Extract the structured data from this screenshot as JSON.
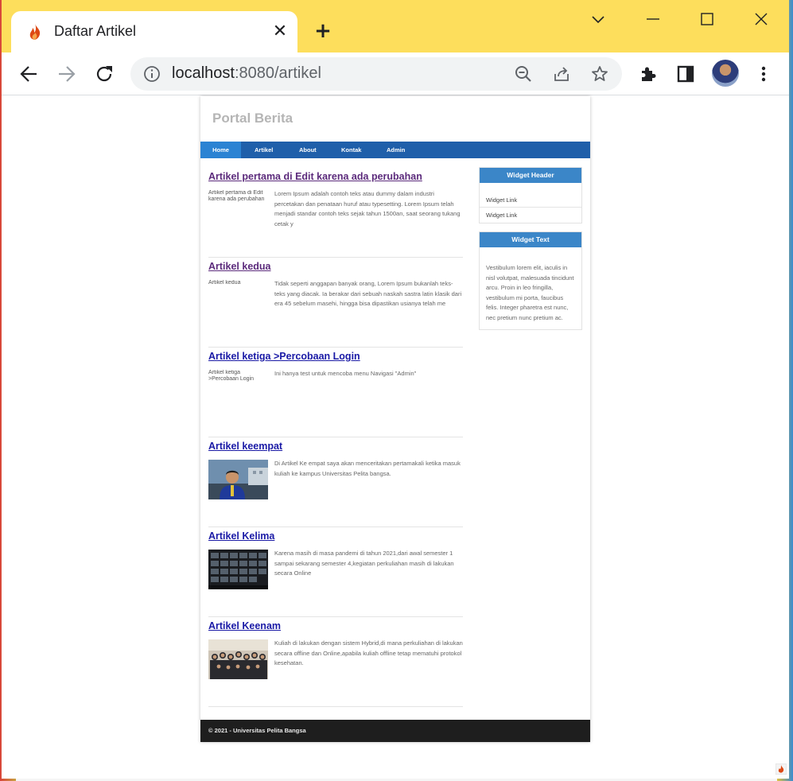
{
  "browser": {
    "tab_title": "Daftar Artikel",
    "url_host": "localhost",
    "url_rest": ":8080/artikel"
  },
  "colors": {
    "tabbar": "#fdde5c",
    "navbar": "#1f5faa",
    "nav_active": "#2b83d3",
    "widget_header": "#3b86c8",
    "footer": "#1e1e1e"
  },
  "site": {
    "title": "Portal Berita",
    "nav": [
      {
        "label": "Home",
        "active": true
      },
      {
        "label": "Artikel"
      },
      {
        "label": "About"
      },
      {
        "label": "Kontak"
      },
      {
        "label": "Admin"
      }
    ]
  },
  "articles": [
    {
      "title": "Artikel pertama di Edit karena ada perubahan",
      "image_alt": "Artikel pertama di Edit karena ada perubahan",
      "image": "broken",
      "text": "Lorem Ipsum adalah contoh teks atau dummy dalam industri percetakan dan penataan huruf atau typesetting. Lorem Ipsum telah menjadi standar contoh teks sejak tahun 1500an, saat seorang tukang cetak y",
      "visited": true
    },
    {
      "title": "Artikel kedua",
      "image_alt": "Artikel kedua",
      "image": "broken",
      "text": "Tidak seperti anggapan banyak orang, Lorem Ipsum bukanlah teks-teks yang diacak. Ia berakar dari sebuah naskah sastra latin klasik dari era 45 sebelum masehi, hingga bisa dipastikan usianya telah me",
      "visited": true
    },
    {
      "title": "Artikel ketiga >Percobaan Login",
      "image_alt": "Artikel ketiga >Percobaan Login",
      "image": "broken",
      "text": "Ini hanya test untuk mencoba menu Navigasi \"Admin\"",
      "visited": false
    },
    {
      "title": "Artikel keempat",
      "image_alt": "",
      "image": "portrait-photo",
      "text": "Di Artikel Ke empat saya akan menceritakan pertamakali ketika masuk kuliah ke kampus Universitas Pelita bangsa.",
      "visited": false
    },
    {
      "title": "Artikel Kelima",
      "image_alt": "",
      "image": "video-call-photo",
      "text": "Karena masih di masa pandemi di tahun 2021,dari awal semester 1 sampai sekarang semester 4,kegiatan perkuliahan masih di lakukan secara Online",
      "visited": false
    },
    {
      "title": "Artikel Keenam",
      "image_alt": "",
      "image": "group-photo",
      "text": "Kuliah di lakukan dengan sistem Hybrid,di mana perkuliahan di lakukan secara offline dan Online,apabila kuliah offline tetap mematuhi protokol kesehatan.",
      "visited": false
    }
  ],
  "sidebar": {
    "widget1": {
      "header": "Widget Header",
      "links": [
        "Widget Link",
        "Widget Link"
      ]
    },
    "widget2": {
      "header": "Widget Text",
      "body": "Vestibulum lorem elit, iaculis in nisl volutpat, malesuada tincidunt arcu. Proin in leo fringilla, vestibulum mi porta, faucibus felis. Integer pharetra est nunc, nec pretium nunc pretium ac."
    }
  },
  "footer": {
    "text": "© 2021 - Universitas Pelita Bangsa"
  }
}
